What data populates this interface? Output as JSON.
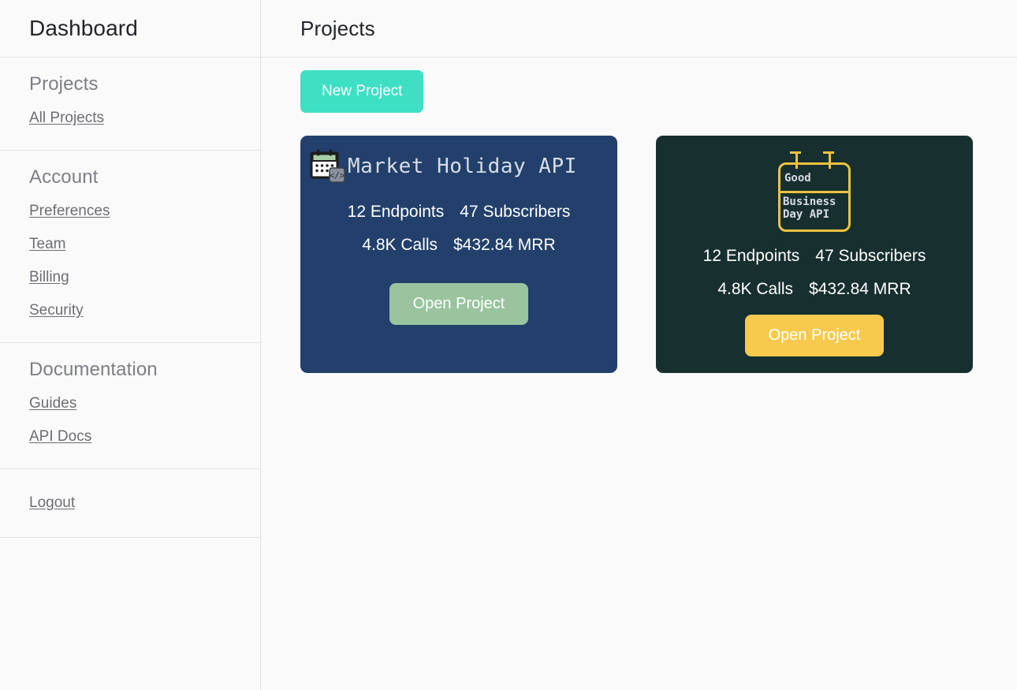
{
  "sidebar": {
    "brand": "Dashboard",
    "sections": [
      {
        "heading": "Projects",
        "links": [
          {
            "label": "All Projects"
          }
        ]
      },
      {
        "heading": "Account",
        "links": [
          {
            "label": "Preferences"
          },
          {
            "label": "Team"
          },
          {
            "label": "Billing"
          },
          {
            "label": "Security"
          }
        ]
      },
      {
        "heading": "Documentation",
        "links": [
          {
            "label": "Guides"
          },
          {
            "label": "API Docs"
          }
        ]
      }
    ],
    "logout": "Logout"
  },
  "header": {
    "title": "Projects"
  },
  "toolbar": {
    "new_project_label": "New Project",
    "new_project_color": "#3fdfc4"
  },
  "cards": [
    {
      "name": "Market Holiday API",
      "icon": "calendar-code-icon",
      "background": "#22406b",
      "endpoints": "12 Endpoints",
      "subscribers": "47 Subscribers",
      "calls": "4.8K Calls",
      "mrr": "$432.84 MRR",
      "open_label": "Open Project",
      "open_color": "#99c49e"
    },
    {
      "name": "Good Business Day API",
      "icon": "calendar-outline-icon",
      "background": "#17302f",
      "logo_line1": "Good",
      "logo_line2": "Business",
      "logo_line3": "Day API",
      "logo_color": "#eec33f",
      "endpoints": "12 Endpoints",
      "subscribers": "47 Subscribers",
      "calls": "4.8K Calls",
      "mrr": "$432.84 MRR",
      "open_label": "Open Project",
      "open_color": "#f7ca4d"
    }
  ]
}
